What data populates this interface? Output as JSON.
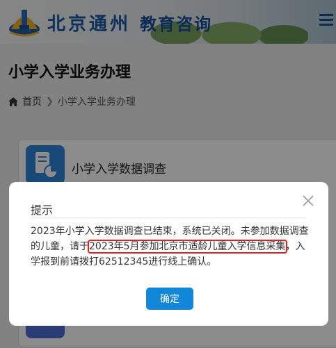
{
  "header": {
    "brand_part1": "北京通州",
    "brand_part2": "教育咨询"
  },
  "page": {
    "title": "小学入学业务办理",
    "breadcrumb": {
      "home": "首页",
      "current": "小学入学业务办理"
    }
  },
  "card": {
    "label": "小学入学数据调查"
  },
  "modal": {
    "title": "提示",
    "body_part1": "2023年小学入学数据调查已结束，系统已关闭。未参加数据调查的儿童，请于",
    "body_highlight": "2023年5月参加北京市适龄儿童入学信息采集",
    "body_part2": "，入学报到前请拨打62512345进行线上确认。",
    "confirm_label": "确定"
  },
  "colors": {
    "brand": "#1a55a4",
    "primary_button": "#1287d8",
    "highlight_border": "#e02020"
  }
}
